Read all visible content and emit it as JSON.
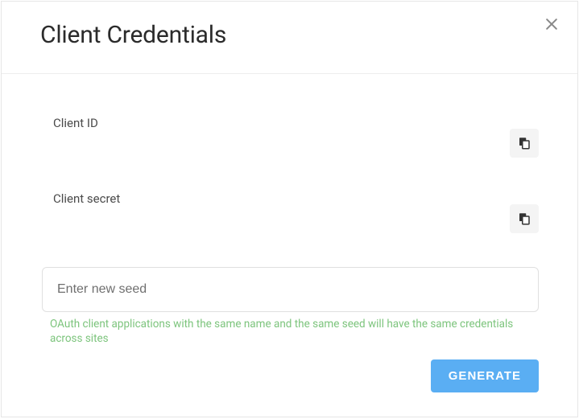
{
  "header": {
    "title": "Client Credentials"
  },
  "fields": {
    "client_id_label": "Client ID",
    "client_secret_label": "Client secret"
  },
  "seed": {
    "placeholder": "Enter new seed",
    "hint": "OAuth client applications with the same name and the same seed will have the same credentials across sites"
  },
  "actions": {
    "generate_label": "GENERATE"
  }
}
